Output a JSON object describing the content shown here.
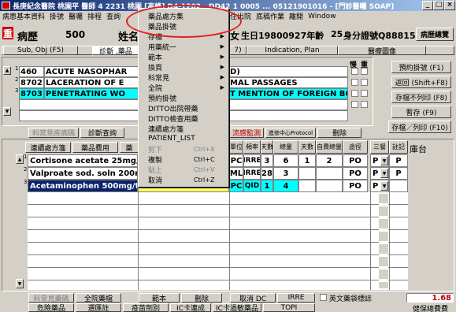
{
  "window": {
    "title": "長庚紀念醫院 桃園平 醫師 4 2231 桃園 [高峰]  D4-1202 - DD42 1 0005 ... 05121901016 - [門診醫囑 SOAP]",
    "min": "_",
    "max": "□",
    "close": "×"
  },
  "menubar": [
    "病患基本資料",
    "掛號",
    "醫囑",
    "排程",
    "查詢",
    "D",
    "住出院",
    "底稿作業",
    "離開",
    "Window"
  ],
  "patient": {
    "tag": "重",
    "chart_label": "病歷",
    "chart_no": "500",
    "name_label": "姓名",
    "sex": "女",
    "birth": "生日19800927年齡",
    "age": "25",
    "id_label": "身分證號Q88815045A",
    "overview_button": "病歷總覽"
  },
  "tabs": {
    "sub_obj": "Sub, Obj (F5)",
    "dx": "診斷 ,藥品",
    "f7": "7)",
    "indication": "Indication, Plan",
    "images": "醫療圖像"
  },
  "dx_panel": {
    "search_label": "鎖藥",
    "h_dx": "慢",
    "h_main": "重",
    "rows": [
      {
        "no": "1",
        "code": "460",
        "desc": "ACUTE NASOPHAR",
        "desc2": "D)",
        "highlight": false
      },
      {
        "no": "2",
        "code": "8702",
        "desc": "LACERATION OF E",
        "desc2": "MAL PASSAGES",
        "highlight": false
      },
      {
        "no": "3",
        "code": "8703",
        "desc": "PENETRATING WO",
        "desc2": "T MENTION OF FOREIGN BODY",
        "highlight": true
      }
    ]
  },
  "right_buttons": [
    "預約掛號 (F1)",
    "返回 (Shift+F8)",
    "存檔不列印 (F8)",
    "暫存 (F9)",
    "存檔／列印 (F10)"
  ],
  "mid_tabs": [
    "科常見疾病碼",
    "診斷查詢",
    "流感監測",
    "進修中心Protocol",
    "刪除"
  ],
  "grid": {
    "toolbar": [
      "連續處方箋",
      "藥品費用",
      "藥"
    ],
    "headers": [
      "單位",
      "頻率",
      "天數",
      "總量",
      "天數",
      "自費總量",
      "途徑",
      "三餐",
      "註記",
      "庫台"
    ],
    "rows": [
      {
        "no": "1",
        "drug": "Cortisone acetate 25mg/tab(p",
        "unit": "PC",
        "freq": "IRRE",
        "days": "3",
        "total": "6",
        "d2": "1",
        "self": "2",
        "route": "PO",
        "meal": "P",
        "note": "P",
        "sel": false
      },
      {
        "no": "2",
        "drug": "Valproate sod. soln 200mg/m",
        "unit": "ML",
        "freq": "IRRE",
        "days": "28",
        "total": "3",
        "d2": "",
        "self": "",
        "route": "PO",
        "meal": "P",
        "note": "P",
        "sel": false
      },
      {
        "no": "3",
        "drug": "Acetaminophen 500mg/tab(pa",
        "unit": "PC",
        "freq": "QID",
        "days": "1",
        "total": "4",
        "d2": "",
        "self": "",
        "route": "PO",
        "meal": "P",
        "note": "",
        "sel": true
      }
    ]
  },
  "bottom": {
    "row1": [
      "科常見藥碼",
      "全院藥檔",
      "範本",
      "刪除",
      "取消 DC",
      "IRRE"
    ],
    "eng_label": "英文藥袋標誌",
    "total": "1.68",
    "row2": [
      "危險藥品",
      "選匯註",
      "疫苗劑別",
      "IC卡連成",
      "IC卡過敏藥品",
      "TOPI"
    ],
    "insurance": "健保總費費"
  },
  "context_menu": {
    "items": [
      {
        "label": "藥品處方集",
        "arrow": false,
        "shortcut": "",
        "disabled": false
      },
      {
        "label": "藥品掛號",
        "arrow": false,
        "shortcut": "",
        "disabled": false
      },
      {
        "label": "存檔",
        "arrow": true,
        "shortcut": "",
        "disabled": false
      },
      {
        "label": "用藥統一",
        "arrow": true,
        "shortcut": "",
        "disabled": false
      },
      {
        "label": "範本",
        "arrow": true,
        "shortcut": "",
        "disabled": false
      },
      {
        "label": "換頁",
        "arrow": true,
        "shortcut": "",
        "disabled": false
      },
      {
        "label": "科常見",
        "arrow": true,
        "shortcut": "",
        "disabled": false
      },
      {
        "label": "全院",
        "arrow": true,
        "shortcut": "",
        "disabled": false
      },
      {
        "label": "預約掛號",
        "arrow": false,
        "shortcut": "",
        "disabled": false
      },
      {
        "label": "DITTO出院帶藥",
        "arrow": false,
        "shortcut": "",
        "disabled": false
      },
      {
        "label": "DITTO檢查用藥",
        "arrow": false,
        "shortcut": "",
        "disabled": false
      },
      {
        "label": "連續處方箋",
        "arrow": false,
        "shortcut": "",
        "disabled": false
      },
      {
        "label": "PATIENT_LIST",
        "arrow": false,
        "shortcut": "",
        "disabled": false
      },
      {
        "label": "剪下",
        "arrow": false,
        "shortcut": "Ctrl+X",
        "disabled": true
      },
      {
        "label": "複製",
        "arrow": false,
        "shortcut": "Ctrl+C",
        "disabled": false
      },
      {
        "label": "貼上",
        "arrow": false,
        "shortcut": "Ctrl+V",
        "disabled": true
      },
      {
        "label": "取消",
        "arrow": false,
        "shortcut": "Ctrl+Z",
        "disabled": false
      }
    ]
  },
  "colors": {
    "highlight_row": "#00ffff",
    "selected_row": "#0a246a",
    "annotation": "#e02020",
    "title_bar": "#0a246a"
  }
}
